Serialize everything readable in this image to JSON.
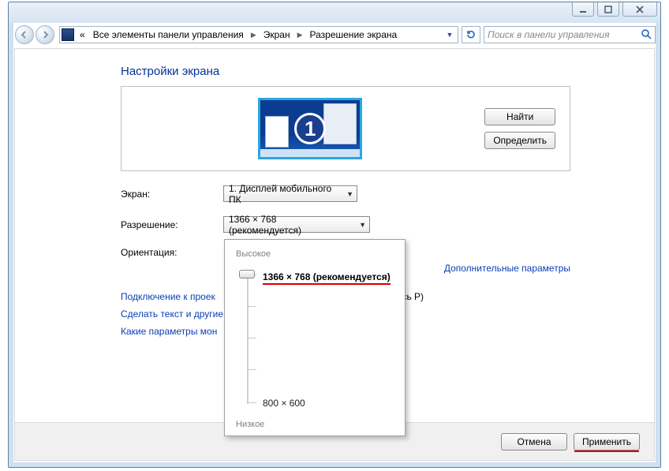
{
  "breadcrumb": {
    "back_symbol": "«",
    "items": [
      "Все элементы панели управления",
      "Экран",
      "Разрешение экрана"
    ]
  },
  "search": {
    "placeholder": "Поиск в панели управления"
  },
  "page": {
    "heading": "Настройки экрана",
    "find_btn": "Найти",
    "identify_btn": "Определить",
    "monitor_number": "1"
  },
  "form": {
    "display_label": "Экран:",
    "display_value": "1. Дисплей мобильного ПК",
    "resolution_label": "Разрешение:",
    "resolution_value": "1366 × 768 (рекомендуется)",
    "orientation_label": "Ориентация:"
  },
  "links": {
    "advanced": "Дополнительные параметры",
    "projector": "Подключение к проек",
    "projector_tail": "сь P)",
    "text_size": "Сделать текст и другие",
    "monitor_params": "Какие параметры мон"
  },
  "footer": {
    "cancel": "Отмена",
    "apply": "Применить"
  },
  "popup": {
    "high": "Высокое",
    "low": "Низкое",
    "top_value": "1366 × 768 (рекомендуется)",
    "bottom_value": "800 × 600"
  }
}
